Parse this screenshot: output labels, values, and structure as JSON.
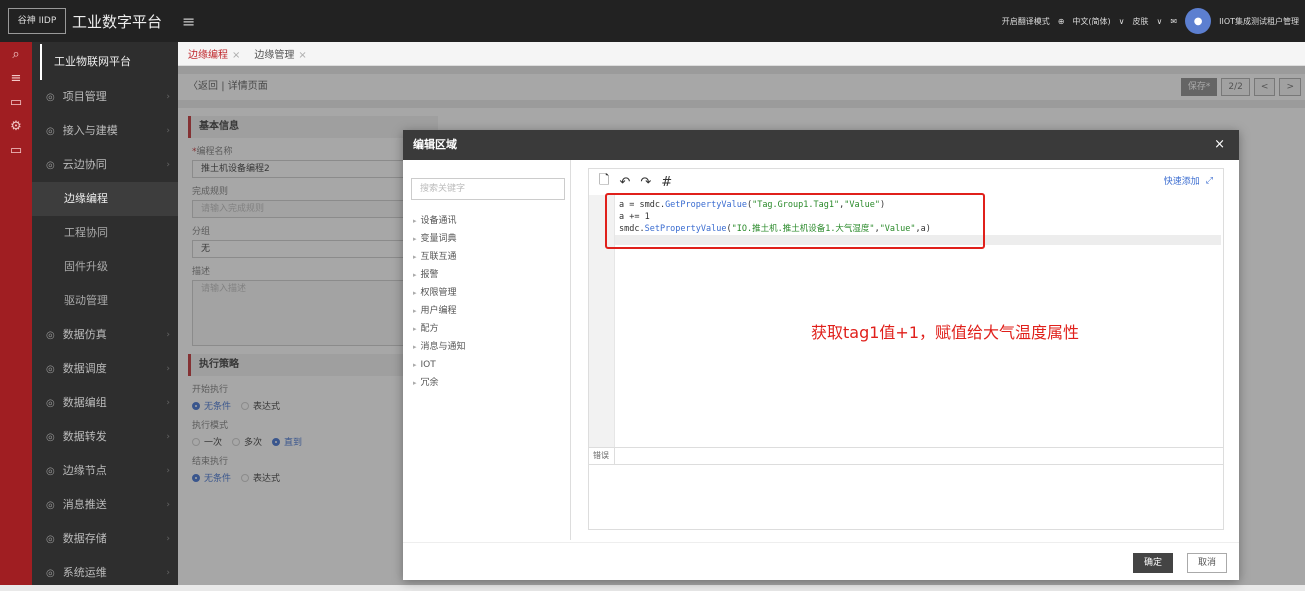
{
  "header": {
    "logo": "谷神 IIDP",
    "title": "工业数字平台",
    "menu_toggle": "≡",
    "translate": "开启翻译模式",
    "language": "中文(简体)",
    "skin": "皮肤",
    "user": "IIOT集成测试租户管理"
  },
  "rail_icons": [
    "search-icon",
    "menu-icon",
    "monitor-icon",
    "gear-icon",
    "monitor-icon"
  ],
  "sidebar": {
    "head": "工业物联网平台",
    "items": [
      {
        "label": "项目管理"
      },
      {
        "label": "接入与建模"
      },
      {
        "label": "云边协同"
      },
      {
        "label": "边缘编程",
        "sub": true,
        "active": true
      },
      {
        "label": "工程协同",
        "sub": true
      },
      {
        "label": "固件升级",
        "sub": true
      },
      {
        "label": "驱动管理",
        "sub": true
      },
      {
        "label": "数据仿真"
      },
      {
        "label": "数据调度"
      },
      {
        "label": "数据编组"
      },
      {
        "label": "数据转发"
      },
      {
        "label": "边缘节点"
      },
      {
        "label": "消息推送"
      },
      {
        "label": "数据存储"
      },
      {
        "label": "系统运维"
      }
    ]
  },
  "tabs": [
    {
      "label": "边缘编程",
      "active": true
    },
    {
      "label": "边缘管理"
    }
  ],
  "breadcrumb": {
    "back": "〈返回",
    "sep": "|",
    "page": "详情页面"
  },
  "toolbar": {
    "save": "保存*",
    "page": "2/2"
  },
  "form": {
    "basic_section": "基本信息",
    "name_label": "编程名称",
    "name_value": "推土机设备编程2",
    "rule_label": "完成规则",
    "rule_placeholder": "请输入完成规则",
    "group_label": "分组",
    "group_value": "无",
    "desc_label": "描述",
    "desc_placeholder": "请输入描述",
    "strategy_section": "执行策略",
    "start_label": "开始执行",
    "start_opt1": "无条件",
    "start_opt2": "表达式",
    "mode_label": "执行模式",
    "mode_opt1": "一次",
    "mode_opt2": "多次",
    "mode_opt3": "直到",
    "end_label": "结束执行",
    "end_opt1": "无条件",
    "end_opt2": "表达式"
  },
  "modal": {
    "title": "编辑区域",
    "close": "×",
    "search_placeholder": "搜索关键字",
    "tree": [
      "设备通讯",
      "变量词典",
      "互联互通",
      "报警",
      "权限管理",
      "用户编程",
      "配方",
      "消息与通知",
      "IOT",
      "冗余"
    ],
    "quick_add": "快速添加",
    "code_lines": [
      {
        "a": "a = smdc.",
        "b": "GetPropertyValue",
        "c": "(",
        "d": "\"Tag.Group1.Tag1\"",
        "e": ",",
        "f": "\"Value\"",
        "g": ")"
      },
      {
        "a": "a += 1",
        "b": "",
        "c": "",
        "d": "",
        "e": "",
        "f": "",
        "g": ""
      },
      {
        "a": "smdc.",
        "b": "SetPropertyValue",
        "c": "(",
        "d": "\"IO.推土机.推土机设备1.大气湿度\"",
        "e": ",",
        "f": "\"Value\"",
        "g": ",a)"
      }
    ],
    "annotation": "获取tag1值+1，赋值给大气温度属性",
    "error_tab": "错误",
    "ok": "确定",
    "cancel": "取消"
  },
  "colors": {
    "accent": "#c0282d",
    "annotation": "#e0201b",
    "link": "#3a6cd0"
  }
}
